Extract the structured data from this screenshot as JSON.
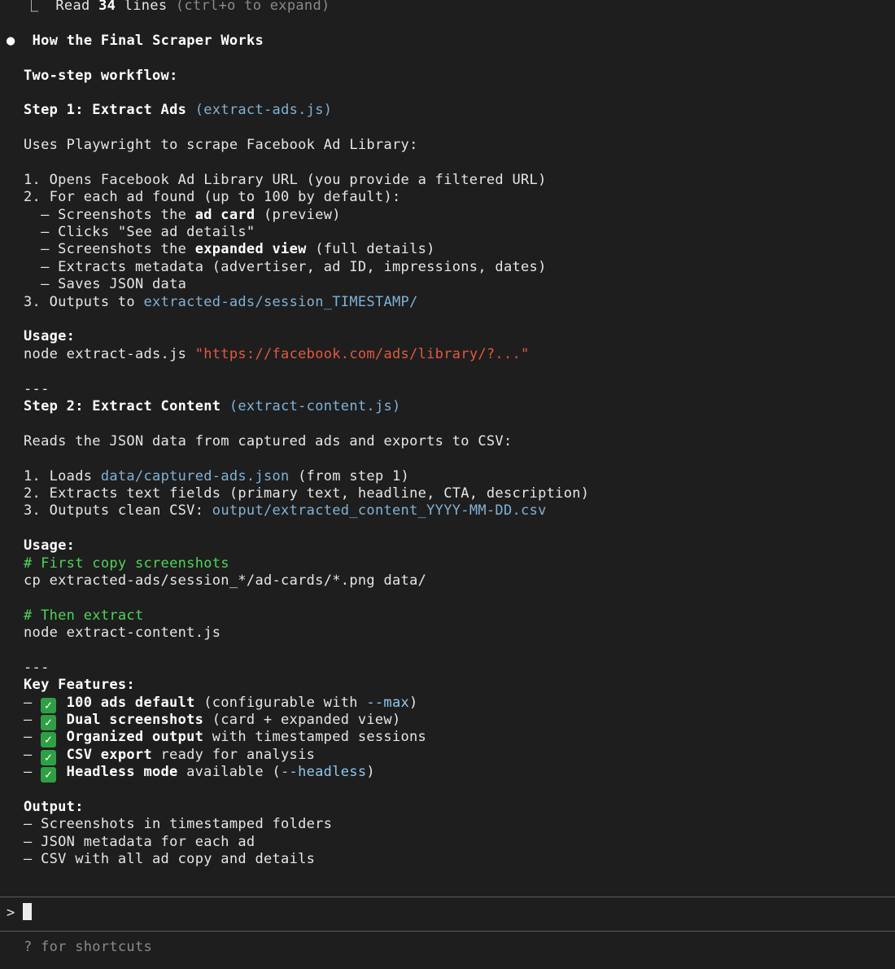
{
  "read_line": {
    "prefix": "⎿  ",
    "read": "Read ",
    "count": "34",
    "lines": " lines",
    "hint": " (ctrl+o to expand)"
  },
  "heading": {
    "bullet": "●",
    "text": "How the Final Scraper Works"
  },
  "workflow": "Two-step workflow:",
  "step1": {
    "title": "Step 1: Extract Ads",
    "file": "(extract-ads.js)",
    "desc": "Uses Playwright to scrape Facebook Ad Library:",
    "item1": "1. Opens Facebook Ad Library URL (you provide a filtered URL)",
    "item2": "2. For each ad found (up to 100 by default):",
    "sub1": {
      "a": "  – Screenshots the ",
      "b": "ad card",
      "c": " (preview)"
    },
    "sub2": "  – Clicks \"See ad details\"",
    "sub3": {
      "a": "  – Screenshots the ",
      "b": "expanded view",
      "c": " (full details)"
    },
    "sub4": "  – Extracts metadata (advertiser, ad ID, impressions, dates)",
    "sub5": "  – Saves JSON data",
    "item3": {
      "a": "3. Outputs to ",
      "path": "extracted-ads/session_TIMESTAMP/"
    },
    "usage_label": "Usage:",
    "usage_cmd": "node extract-ads.js ",
    "usage_arg": "\"https://facebook.com/ads/library/?...\""
  },
  "divider": "---",
  "step2": {
    "title": "Step 2: Extract Content",
    "file": "(extract-content.js)",
    "desc": "Reads the JSON data from captured ads and exports to CSV:",
    "item1": {
      "a": "1. Loads ",
      "path": "data/captured-ads.json",
      "c": " (from step 1)"
    },
    "item2": "2. Extracts text fields (primary text, headline, CTA, description)",
    "item3": {
      "a": "3. Outputs clean CSV: ",
      "path": "output/extracted_content_YYYY-MM-DD.csv"
    },
    "usage_label": "Usage:",
    "comment1": "# First copy screenshots",
    "cmd1": "cp extracted-ads/session_*/ad-cards/*.png data/",
    "comment2": "# Then extract",
    "cmd2": "node extract-content.js"
  },
  "features": {
    "label": "Key Features:",
    "dash": "– ",
    "check": "✓",
    "f1": {
      "b": "100 ads default",
      "c": " (configurable with ",
      "d": "--max",
      "e": ")"
    },
    "f2": {
      "b": "Dual screenshots",
      "c": " (card + expanded view)"
    },
    "f3": {
      "b": "Organized output",
      "c": " with timestamped sessions"
    },
    "f4": {
      "b": "CSV export",
      "c": " ready for analysis"
    },
    "f5": {
      "b": "Headless mode",
      "c": " available (",
      "d": "--headless",
      "e": ")"
    }
  },
  "output": {
    "label": "Output:",
    "o1": "– Screenshots in timestamped folders",
    "o2": "– JSON metadata for each ad",
    "o3": "– CSV with all ad copy and details"
  },
  "prompt": {
    "symbol": ">"
  },
  "footer_hint": "? for shortcuts",
  "colors": {
    "background": "#1e1e1e",
    "path": "#7fb2d8",
    "string": "#e4583e",
    "comment": "#4fd35a",
    "check": "#2ea043"
  }
}
